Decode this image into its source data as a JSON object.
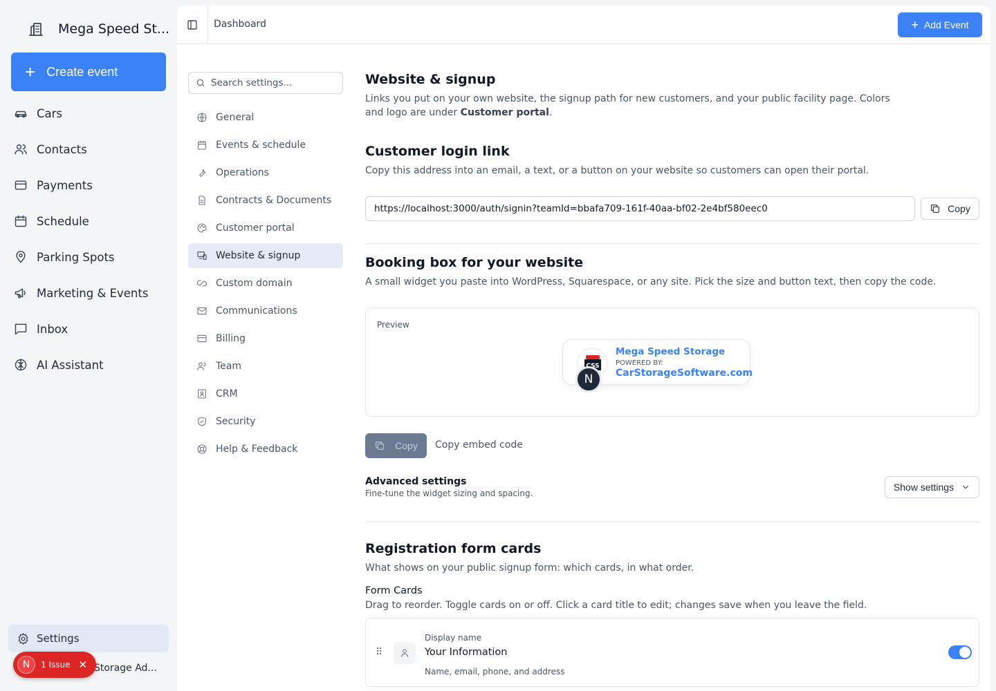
{
  "sidebar": {
    "brand": "Mega Speed St...",
    "create_label": "Create event",
    "items": [
      {
        "label": "Cars",
        "icon": "car-icon"
      },
      {
        "label": "Contacts",
        "icon": "users-icon"
      },
      {
        "label": "Payments",
        "icon": "credit-card-icon"
      },
      {
        "label": "Schedule",
        "icon": "calendar-icon"
      },
      {
        "label": "Parking Spots",
        "icon": "map-pin-icon"
      },
      {
        "label": "Marketing & Events",
        "icon": "megaphone-icon"
      },
      {
        "label": "Inbox",
        "icon": "message-square-icon"
      },
      {
        "label": "AI Assistant",
        "icon": "brain-icon"
      }
    ],
    "settings_label": "Settings",
    "account_label": "Storage Ad...",
    "issue_badge": {
      "avatar": "N",
      "label": "1 Issue"
    }
  },
  "topbar": {
    "breadcrumb": "Dashboard",
    "add_event_label": "Add Event"
  },
  "settings_nav": {
    "search_placeholder": "Search settings...",
    "items": [
      {
        "label": "General",
        "icon": "globe-icon"
      },
      {
        "label": "Events & schedule",
        "icon": "calendar-icon"
      },
      {
        "label": "Operations",
        "icon": "wrench-icon"
      },
      {
        "label": "Contracts & Documents",
        "icon": "file-icon"
      },
      {
        "label": "Customer portal",
        "icon": "palette-icon"
      },
      {
        "label": "Website & signup",
        "icon": "devices-icon",
        "active": true
      },
      {
        "label": "Custom domain",
        "icon": "link-icon"
      },
      {
        "label": "Communications",
        "icon": "mail-icon"
      },
      {
        "label": "Billing",
        "icon": "credit-card-icon"
      },
      {
        "label": "Team",
        "icon": "users-icon"
      },
      {
        "label": "CRM",
        "icon": "contact-icon"
      },
      {
        "label": "Security",
        "icon": "shield-icon"
      },
      {
        "label": "Help & Feedback",
        "icon": "lifebuoy-icon"
      }
    ]
  },
  "content": {
    "title": "Website & signup",
    "desc_part1": "Links you put on your own website, the signup path for new customers, and your public facility page. Colors and logo are under ",
    "desc_bold": "Customer portal",
    "desc_part2": ".",
    "login": {
      "title": "Customer login link",
      "desc": "Copy this address into an email, a text, or a button on your website so customers can open their portal.",
      "url": "https://localhost:3000/auth/signin?teamId=bbafa709-161f-40aa-bf02-2e4bf580eec0",
      "copy_label": "Copy"
    },
    "booking": {
      "title": "Booking box for your website",
      "desc": "A small widget you paste into WordPress, Squarespace, or any site. Pick the size and button text, then copy the code.",
      "preview_label": "Preview",
      "widget_name": "Mega Speed Storage",
      "widget_powered": "POWERED BY:",
      "widget_site": "CarStorageSoftware.com",
      "widget_logo_text": "CSS",
      "widget_avatar": "N",
      "copy_label": "Copy",
      "embed_label": "Copy embed code",
      "advanced_title": "Advanced settings",
      "advanced_sub": "Fine-tune the widget sizing and spacing.",
      "show_settings_label": "Show settings"
    },
    "registration": {
      "title": "Registration form cards",
      "desc": "What shows on your public signup form: which cards, in what order.",
      "form_cards_label": "Form Cards",
      "form_cards_desc": "Drag to reorder. Toggle cards on or off. Click a card title to edit; changes save when you leave the field.",
      "card": {
        "display_name_label": "Display name",
        "title": "Your Information",
        "sub": "Name, email, phone, and address",
        "enabled": true
      }
    }
  },
  "colors": {
    "accent": "#3b82f6",
    "issue": "#dc2626",
    "active_nav": "#e5eaf6"
  }
}
